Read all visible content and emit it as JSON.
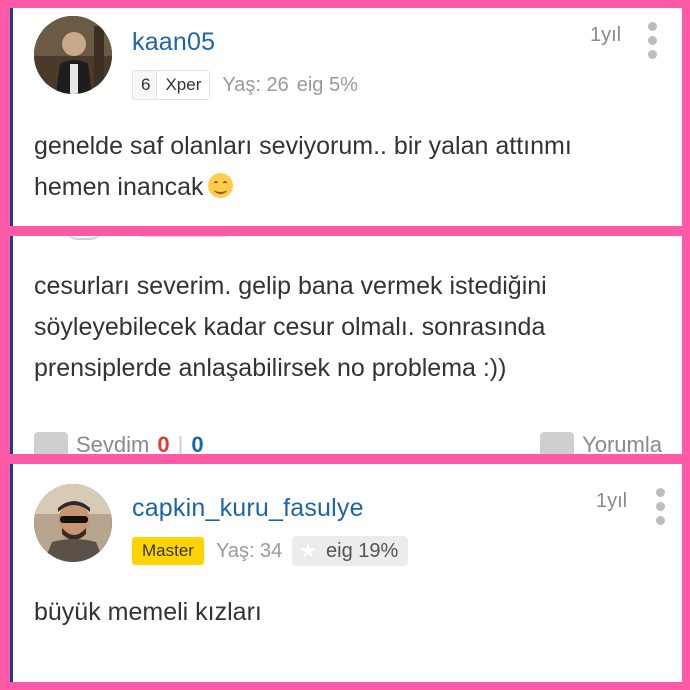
{
  "comments": [
    {
      "username": "kaan05",
      "time": "1yıl",
      "level_num": "6",
      "level_title": "Xper",
      "age": "Yaş: 26",
      "eig": "eig 5%",
      "text_line1": "genelde saf olanları seviyorum.. bir yalan attınmı",
      "text_line2": "hemen inancak"
    },
    {
      "text_line1": "cesurları severim. gelip bana vermek istediğini",
      "text_line2": "söyleyebilecek kadar cesur olmalı. sonrasında",
      "text_line3": "prensiplerde anlaşabilirsek no problema :))",
      "like_label": "Sevdim",
      "like_count": "0",
      "separator": "|",
      "dislike_count": "0",
      "reply_label": "Yorumla"
    },
    {
      "username": "capkin_kuru_fasulye",
      "time": "1yıl",
      "badge": "Master",
      "age": "Yaş: 34",
      "eig": "eig 19%",
      "text_line1": "büyük memeli kızları"
    }
  ],
  "icons": {
    "more": "vertical-dots-icon",
    "smile": "smiling-face-icon",
    "thumb": "thumbs-up-icon",
    "comment": "comment-icon",
    "star": "star-icon"
  },
  "colors": {
    "background_frame": "#ff5aa8",
    "username": "#1a66a8",
    "master_badge": "#ffd400",
    "like_count": "#e53935",
    "dislike_count": "#1a66a8",
    "left_accent": "#1b3f8f"
  }
}
